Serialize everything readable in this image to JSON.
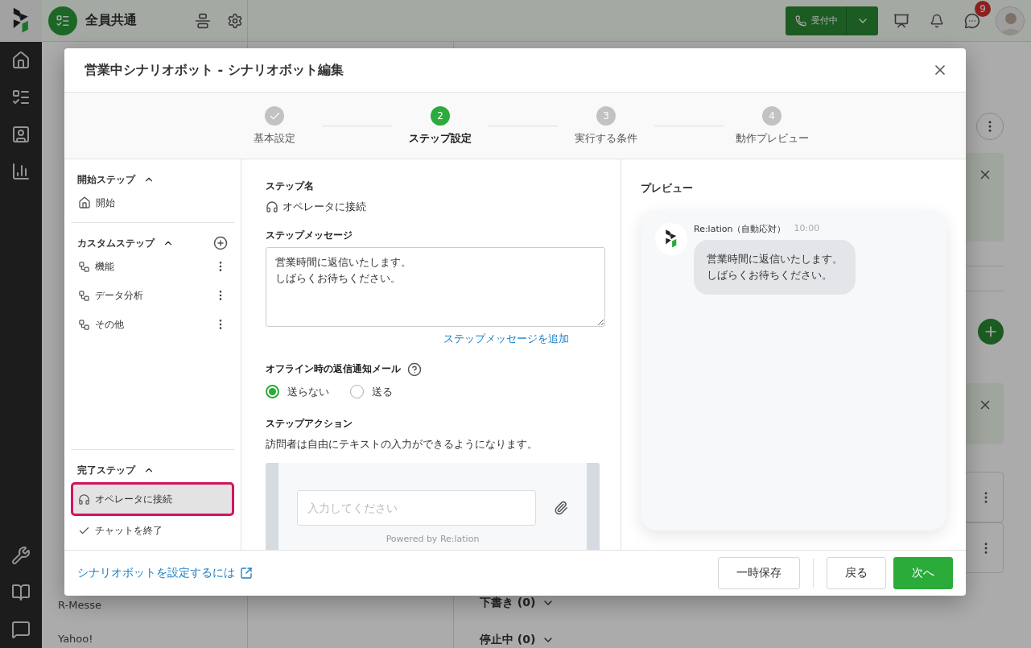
{
  "app": {
    "workspace": "全員共通",
    "status_button": "受付中",
    "notification_count": "9"
  },
  "background": {
    "channels": [
      "R-Messe",
      "Yahoo!"
    ],
    "sections": [
      {
        "label": "下書き (0)"
      },
      {
        "label": "停止中 (0)"
      }
    ]
  },
  "modal": {
    "title": "営業中シナリオボット - シナリオボット編集",
    "steps": [
      {
        "label": "基本設定",
        "completed": true,
        "selected": false
      },
      {
        "number": "2",
        "label": "ステップ設定",
        "completed": false,
        "selected": true
      },
      {
        "number": "3",
        "label": "実行する条件",
        "completed": false,
        "selected": false
      },
      {
        "number": "4",
        "label": "動作プレビュー",
        "completed": false,
        "selected": false
      }
    ],
    "step_groups": [
      {
        "kind": "start",
        "title": "開始ステップ",
        "expanded": true,
        "items": [
          {
            "label": "開始",
            "selected": false
          }
        ]
      },
      {
        "kind": "custom",
        "title": "カスタムステップ",
        "expanded": true,
        "items": [
          {
            "label": "機能",
            "selected": false
          },
          {
            "label": "データ分析",
            "selected": false
          },
          {
            "label": "その他",
            "selected": false
          }
        ]
      },
      {
        "kind": "end",
        "title": "完了ステップ",
        "expanded": true,
        "items": [
          {
            "kind": "operator",
            "label": "オペレータに接続",
            "selected": true
          },
          {
            "kind": "close",
            "label": "チャットを終了",
            "selected": false
          }
        ]
      }
    ],
    "editor": {
      "step_name_label": "ステップ名",
      "step_name": "オペレータに接続",
      "message_label": "ステップメッセージ",
      "message_lines": [
        "営業時間に返信いたします。",
        "しばらくお待ちください。"
      ],
      "add_message_link": "ステップメッセージを追加",
      "offline_label": "オフライン時の返信通知メール",
      "offline_options": [
        {
          "label": "送らない",
          "selected": true
        },
        {
          "label": "送る",
          "selected": false
        }
      ],
      "action_label": "ステップアクション",
      "action_description": "訪問者は自由にテキストの入力ができるようになります。",
      "widget_placeholder": "入力してください",
      "widget_powered": "Powered by Re:lation"
    },
    "preview": {
      "title": "プレビュー",
      "sender": "Re:lation（自動応対）",
      "time": "10:00",
      "message_lines": [
        "営業時間に返信いたします。",
        "しばらくお待ちください。"
      ]
    },
    "footer": {
      "help_link": "シナリオボットを設定するには",
      "save_button": "一時保存",
      "back_button": "戻る",
      "next_button": "次へ"
    }
  }
}
